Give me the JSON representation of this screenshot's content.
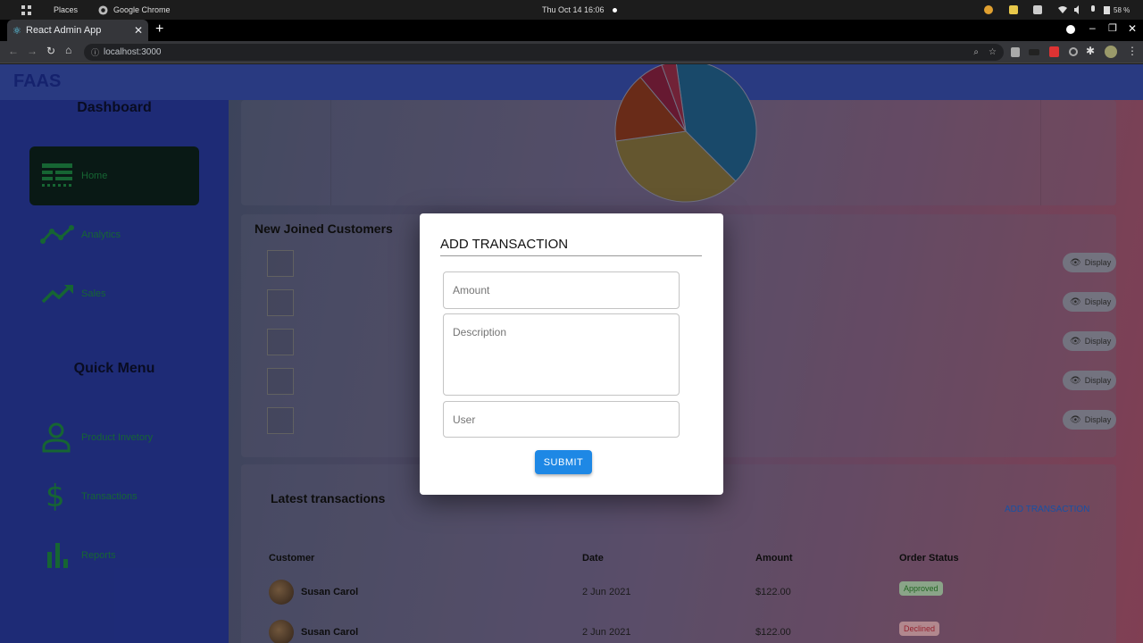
{
  "os": {
    "activities": "Places",
    "app_name": "Google Chrome",
    "datetime": "Thu Oct 14  16:06",
    "battery": "58 %"
  },
  "browser": {
    "tab_title": "React Admin App",
    "url": "localhost:3000"
  },
  "app": {
    "brand": "FAAS",
    "sidebar": {
      "heading": "Dashboard",
      "items": [
        {
          "label": "Home",
          "icon": "dashboard-icon",
          "active": true
        },
        {
          "label": "Analytics",
          "icon": "timeline-icon"
        },
        {
          "label": "Sales",
          "icon": "trending-up-icon"
        }
      ],
      "quick_heading": "Quick Menu",
      "quick_items": [
        {
          "label": "Product Invetory",
          "icon": "person-icon"
        },
        {
          "label": "Transactions",
          "icon": "dollar-icon"
        },
        {
          "label": "Reports",
          "icon": "bar-chart-icon"
        }
      ]
    },
    "pie_colors": [
      "#1f5a82",
      "#7a6a3a",
      "#80351e",
      "#7d1f3c",
      "#8a2a44"
    ],
    "new_customers": {
      "title": "New Joined Customers",
      "display_label": "Display",
      "count": 5
    },
    "transactions": {
      "title": "Latest transactions",
      "add_label": "ADD TRANSACTION",
      "headers": [
        "Customer",
        "Date",
        "Amount",
        "Order Status"
      ],
      "rows": [
        {
          "customer": "Susan Carol",
          "date": "2 Jun 2021",
          "amount": "$122.00",
          "status": "Approved"
        },
        {
          "customer": "Susan Carol",
          "date": "2 Jun 2021",
          "amount": "$122.00",
          "status": "Declined"
        }
      ]
    }
  },
  "modal": {
    "title": "ADD TRANSACTION",
    "amount_placeholder": "Amount",
    "description_placeholder": "Description",
    "user_placeholder": "User",
    "submit_label": "SUBMIT"
  }
}
